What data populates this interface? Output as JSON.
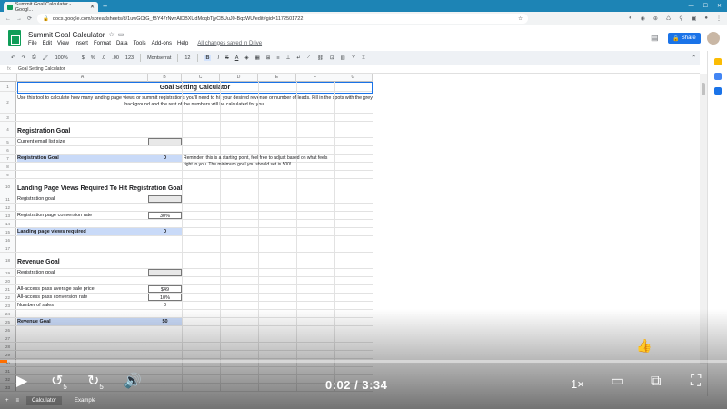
{
  "browser": {
    "tab_title": "Summit Goal Calculator - Googl...",
    "new_tab": "+",
    "url": "docs.google.com/spreadsheets/d/1uwGOtG_fBY47rNwrAlDBXUdMcqbTjyCBUuJ0-BqxWU/edit#gid=1172501722"
  },
  "doc": {
    "title": "Summit Goal Calculator",
    "menu": [
      "File",
      "Edit",
      "View",
      "Insert",
      "Format",
      "Data",
      "Tools",
      "Add-ons",
      "Help"
    ],
    "saved_status": "All changes saved in Drive",
    "share_label": "Share"
  },
  "toolbar": {
    "zoom": "100%",
    "currency": "$",
    "percent": "%",
    "decimals_less": ".0",
    "decimals_more": ".00",
    "format_123": "123",
    "font": "Montserrat",
    "font_size": "12",
    "bold": "B",
    "italic": "I",
    "strike": "S",
    "text_color": "A"
  },
  "formula_bar": {
    "fx": "fx",
    "value": "Goal Setting Calculator"
  },
  "columns": [
    "A",
    "B",
    "C",
    "D",
    "E",
    "F",
    "G"
  ],
  "rows": [
    {
      "n": "1",
      "text": "Goal Setting Calculator",
      "kind": "title"
    },
    {
      "n": "2",
      "text": "Use this tool to calculate how many landing page views or summit registrations you'll need to hit your desired revenue or number of leads. Fill in the spots with the grey background and the rest of the numbers will be calculated for you.",
      "kind": "intro"
    },
    {
      "n": "3",
      "text": "",
      "kind": "blank"
    },
    {
      "n": "4",
      "text": "Registration Goal",
      "kind": "section"
    },
    {
      "n": "5",
      "text": "Current email list size",
      "value": "",
      "kind": "input"
    },
    {
      "n": "6",
      "text": "",
      "kind": "blank"
    },
    {
      "n": "7",
      "text": "Registration Goal",
      "value": "0",
      "kind": "result",
      "note": "Reminder: this is a starting point, feel free to adjust based on what feels right to you. The minimum goal you should set is 500!"
    },
    {
      "n": "8",
      "text": "",
      "kind": "blank"
    },
    {
      "n": "9",
      "text": "",
      "kind": "blank"
    },
    {
      "n": "10",
      "text": "Landing Page Views Required To Hit Registration Goal",
      "kind": "section"
    },
    {
      "n": "11",
      "text": "Registration goal",
      "value": "",
      "kind": "input"
    },
    {
      "n": "12",
      "text": "",
      "kind": "blank"
    },
    {
      "n": "13",
      "text": "Registration page conversion rate",
      "value": "30%",
      "kind": "box"
    },
    {
      "n": "14",
      "text": "",
      "kind": "blank"
    },
    {
      "n": "15",
      "text": "Landing page views required",
      "value": "0",
      "kind": "result"
    },
    {
      "n": "16",
      "text": "",
      "kind": "blank"
    },
    {
      "n": "17",
      "text": "",
      "kind": "blank"
    },
    {
      "n": "18",
      "text": "Revenue Goal",
      "kind": "section"
    },
    {
      "n": "19",
      "text": "Registration goal",
      "value": "",
      "kind": "input"
    },
    {
      "n": "20",
      "text": "",
      "kind": "blank"
    },
    {
      "n": "21",
      "text": "All-access pass average sale price",
      "value": "$49",
      "kind": "box"
    },
    {
      "n": "22",
      "text": "All-access pass conversion rate",
      "value": "10%",
      "kind": "box"
    },
    {
      "n": "23",
      "text": "Number of sales",
      "value": "0",
      "kind": "plain"
    },
    {
      "n": "24",
      "text": "",
      "kind": "blank"
    },
    {
      "n": "25",
      "text": "Revenue Goal",
      "value": "$0",
      "kind": "result"
    },
    {
      "n": "26",
      "text": "",
      "kind": "blank"
    },
    {
      "n": "27",
      "text": "",
      "kind": "blank"
    },
    {
      "n": "28",
      "text": "",
      "kind": "blank"
    },
    {
      "n": "29",
      "text": "",
      "kind": "blank"
    },
    {
      "n": "30",
      "text": "",
      "kind": "blank"
    },
    {
      "n": "31",
      "text": "",
      "kind": "blank"
    },
    {
      "n": "32",
      "text": "",
      "kind": "blank"
    },
    {
      "n": "33",
      "text": "",
      "kind": "blank"
    }
  ],
  "sheet_tabs": [
    "Calculator",
    "Example"
  ],
  "video": {
    "time": "0:02 / 3:34",
    "speed": "1×",
    "progress": 0.01,
    "rewind": "5",
    "forward": "5"
  },
  "colors": {
    "accent": "#1a73e8",
    "sheets_green": "#0f9d58",
    "result_fill": "#c9daf8",
    "progress": "#ff6f00"
  }
}
